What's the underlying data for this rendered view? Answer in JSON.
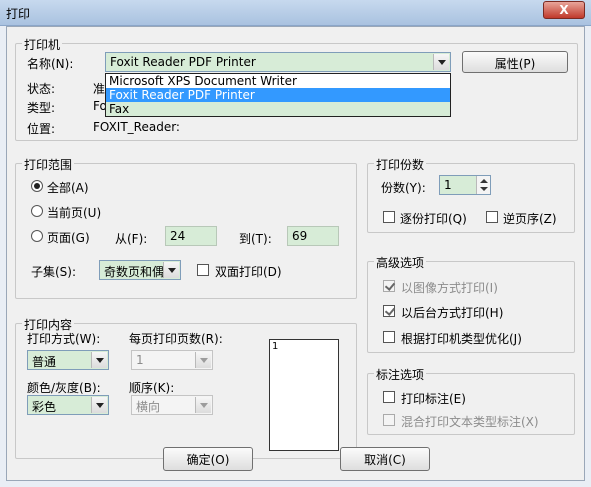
{
  "window": {
    "title": "打印",
    "close_label": "X"
  },
  "printer": {
    "legend": "打印机",
    "name_label": "名称(N):",
    "selected": "Foxit Reader PDF Printer",
    "options": [
      "Microsoft XPS Document Writer",
      "Foxit Reader PDF Printer",
      "Fax"
    ],
    "properties_label": "属性(P)",
    "status_label": "状态:",
    "status_value": "准",
    "type_label": "类型:",
    "type_value": "Fo",
    "location_label": "位置:",
    "location_value": "FOXIT_Reader:"
  },
  "range": {
    "legend": "打印范围",
    "all_label": "全部(A)",
    "current_label": "当前页(U)",
    "pages_label": "页面(G)",
    "from_label": "从(F):",
    "from_value": "24",
    "to_label": "到(T):",
    "to_value": "69",
    "subset_label": "子集(S):",
    "subset_value": "奇数页和偶",
    "duplex_label": "双面打印(D)"
  },
  "copies": {
    "legend": "打印份数",
    "count_label": "份数(Y):",
    "count_value": "1",
    "collate_label": "逐份打印(Q)",
    "reverse_label": "逆页序(Z)"
  },
  "advanced": {
    "legend": "高级选项",
    "as_image_label": "以图像方式打印(I)",
    "background_label": "以后台方式打印(H)",
    "optimize_label": "根据打印机类型优化(J)"
  },
  "content": {
    "legend": "打印内容",
    "mode_label": "打印方式(W):",
    "mode_value": "普通",
    "per_sheet_label": "每页打印页数(R):",
    "per_sheet_value": "1",
    "color_label": "颜色/灰度(B):",
    "color_value": "彩色",
    "order_label": "顺序(K):",
    "order_value": "横向",
    "preview_number": "1"
  },
  "annotations": {
    "legend": "标注选项",
    "print_label": "打印标注(E)",
    "mixed_label": "混合打印文本类型标注(X)"
  },
  "buttons": {
    "ok": "确定(O)",
    "cancel": "取消(C)"
  }
}
